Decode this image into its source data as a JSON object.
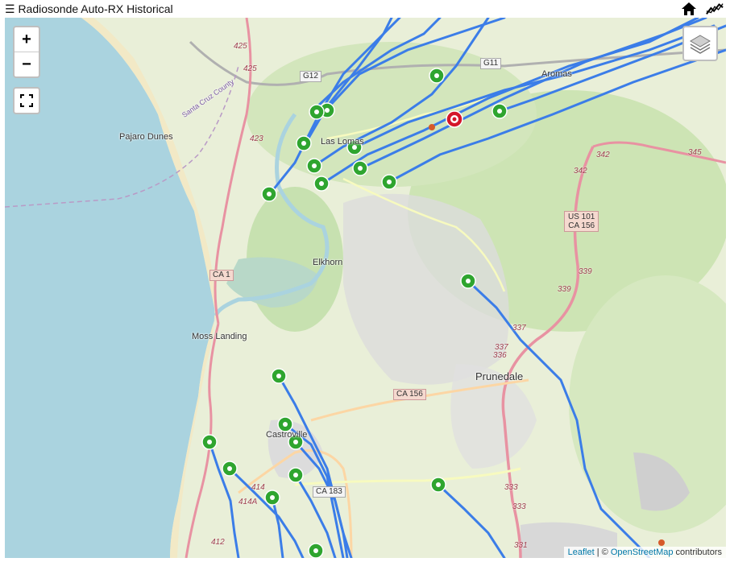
{
  "header": {
    "title": "☰ Radiosonde Auto-RX Historical",
    "home_icon": "home-icon",
    "chart_icon": "chart-icon"
  },
  "controls": {
    "zoom_in": "+",
    "zoom_out": "−",
    "fullscreen_icon": "fullscreen-icon",
    "layers_icon": "layers-icon"
  },
  "places": [
    {
      "name": "Pajaro Dunes"
    },
    {
      "name": "Las Lomas"
    },
    {
      "name": "Aromas"
    },
    {
      "name": "Elkhorn"
    },
    {
      "name": "Moss Landing"
    },
    {
      "name": "Prunedale"
    },
    {
      "name": "Castroville"
    },
    {
      "name": "Santa Cruz County"
    }
  ],
  "road_shields": [
    "G12",
    "G11",
    "CA 1",
    "CA 156",
    "US 101",
    "CA 156",
    "CA 183"
  ],
  "route_numbers": [
    "425",
    "425",
    "423",
    "342",
    "342",
    "345",
    "339",
    "339",
    "337",
    "337",
    "336",
    "414",
    "414A",
    "412",
    "333",
    "333",
    "331"
  ],
  "attribution": {
    "leaflet": "Leaflet",
    "sep": " | © ",
    "osm": "OpenStreetMap",
    "suffix": " contributors"
  },
  "colors": {
    "track": "#3b7de8",
    "marker_green": "#3cc43c",
    "marker_red": "#d4162a",
    "water": "#aad3df",
    "land": "#e9efd8"
  },
  "markers": {
    "green_count": 22,
    "red_count": 1
  }
}
